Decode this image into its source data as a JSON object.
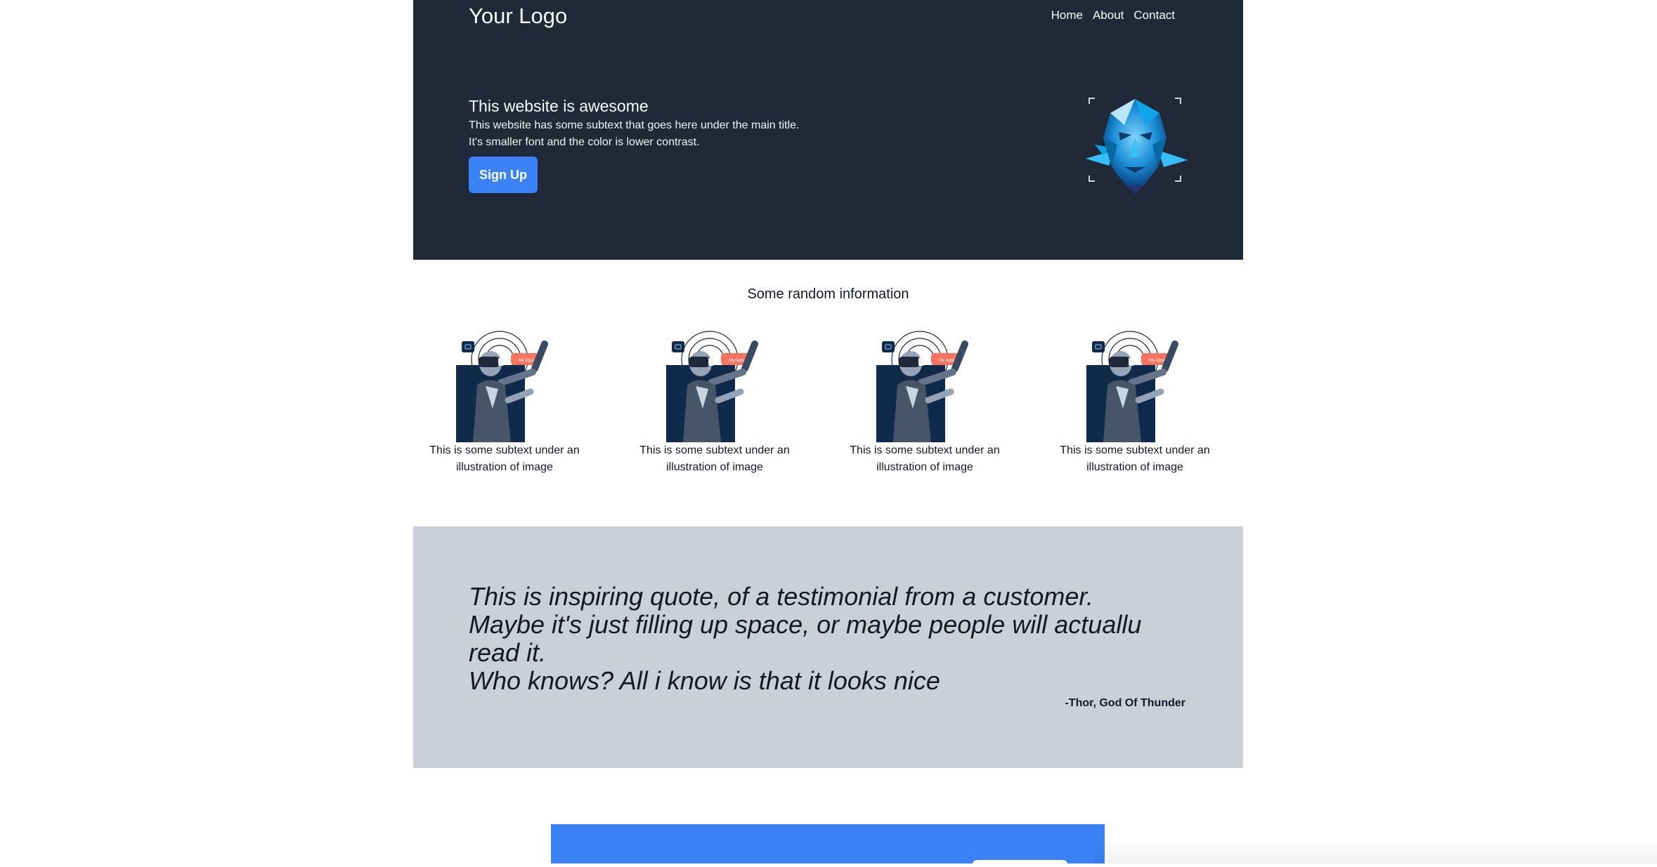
{
  "header": {
    "logo": "Your Logo",
    "nav": [
      "Home",
      "About",
      "Contact"
    ]
  },
  "hero": {
    "title": "This website is awesome",
    "subtext_line1": "This website has some subtext that goes here under the main title.",
    "subtext_line2": "It's smaller font and the color is lower contrast.",
    "button_label": "Sign Up",
    "image_icon": "polygon-face-illustration"
  },
  "features": {
    "title": "Some random information",
    "card_icon": "vr-headset-person-illustration",
    "badge_label": "My Apps",
    "items": [
      {
        "caption_line1": "This is some subtext under an",
        "caption_line2": "illustration of image"
      },
      {
        "caption_line1": "This is some subtext under an",
        "caption_line2": "illustration of image"
      },
      {
        "caption_line1": "This is some subtext under an",
        "caption_line2": "illustration of image"
      },
      {
        "caption_line1": "This is some subtext under an",
        "caption_line2": "illustration of image"
      }
    ]
  },
  "quote": {
    "line1": "This is inspiring quote, of a testimonial from a customer.",
    "line2": "Maybe it's just filling up space, or maybe people will actuallu read it.",
    "line3": "Who knows? All i know is that it looks nice",
    "author": "-Thor, God Of Thunder"
  },
  "colors": {
    "hero_bg": "#1f2937",
    "accent": "#3b82f6",
    "quote_bg": "#cbd0d7",
    "badge": "#f97360"
  }
}
